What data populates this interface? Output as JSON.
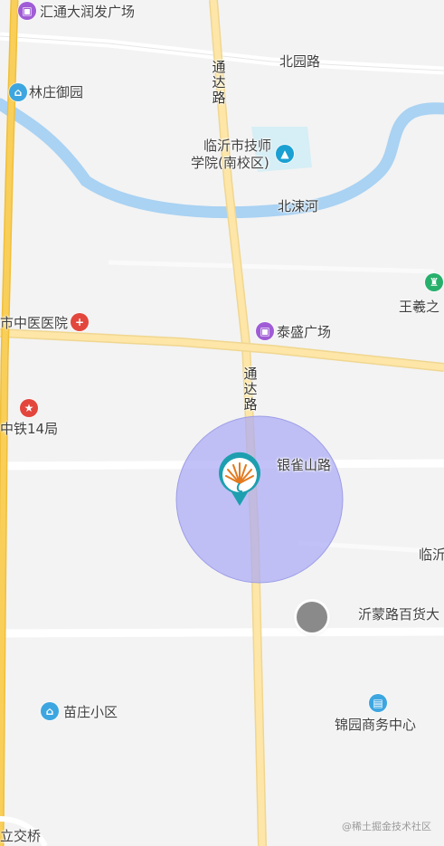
{
  "map": {
    "roads": {
      "north": "北园路",
      "tongda_upper": "通达路",
      "tongda_lower": "通达路",
      "yinque": "银雀山路",
      "yimeng": "沂蒙路百货大"
    },
    "river": "北涑河",
    "pois": {
      "huitong": "汇通大润发广场",
      "linzhuang": "林庄御园",
      "school_line1": "临沂市技师",
      "school_line2": "学院(南校区)",
      "wangxi": "王羲之",
      "hospital": "市中医医院",
      "taisheng": "泰盛广场",
      "zhongtie": "中铁14局",
      "linyi_right": "临沂",
      "miaozhuang": "苗庄小区",
      "jinyuan": "锦园商务中心",
      "bridge": "立交桥"
    },
    "watermark": "@稀土掘金技术社区",
    "colors": {
      "accuracy_circle": "#aaaaf5",
      "river": "#a9d2f3",
      "main_road": "#fde6a7",
      "highway": "#f7c94d",
      "marker_ring": "#1e9fb0"
    },
    "icons": {
      "huitong": "shopping-bag-icon",
      "linzhuang": "residential-icon",
      "school": "school-cap-icon",
      "wangxi": "scenic-icon",
      "hospital": "hospital-cross-icon",
      "taisheng": "shopping-bag-icon",
      "zhongtie": "company-icon",
      "miaozhuang": "residential-icon",
      "jinyuan": "office-building-icon",
      "marker": "peacock-logo-marker-icon",
      "gps": "locate-button-icon"
    }
  }
}
